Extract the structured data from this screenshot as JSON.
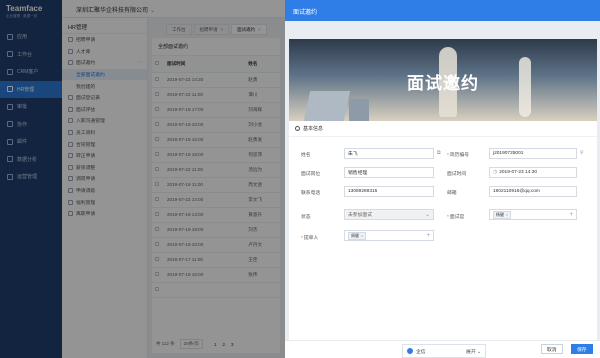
{
  "brand": {
    "name": "Teamface",
    "subtitle": "企业管理 · 数据一切"
  },
  "nav": [
    "应用",
    "工作台",
    "CRM客户",
    "HR管理",
    "审批",
    "协作",
    "邮件",
    "数据分析",
    "运营管理"
  ],
  "nav_active_index": 3,
  "topbar": {
    "company": "深圳汇聚华企科技有限公司",
    "chevron": "⌄"
  },
  "submenu": {
    "title": "HR管理",
    "items": [
      {
        "label": "招聘申请",
        "child": false
      },
      {
        "label": "人才库",
        "child": false
      },
      {
        "label": "面试邀约",
        "child": false,
        "more": "···"
      },
      {
        "label": "全部面试邀约",
        "child": true,
        "selected": true
      },
      {
        "label": "我创建的",
        "child": true
      },
      {
        "label": "面试登记表",
        "child": false
      },
      {
        "label": "面试评估",
        "child": false
      },
      {
        "label": "入职沟通管理",
        "child": false
      },
      {
        "label": "员工资料",
        "child": false
      },
      {
        "label": "合同管理",
        "child": false
      },
      {
        "label": "转正申请",
        "child": false
      },
      {
        "label": "薪资调整",
        "child": false
      },
      {
        "label": "调岗申请",
        "child": false
      },
      {
        "label": "申请调级",
        "child": false
      },
      {
        "label": "福利管理",
        "child": false
      },
      {
        "label": "离职申请",
        "child": false
      }
    ]
  },
  "tabs": [
    {
      "label": "工作台",
      "active": false
    },
    {
      "label": "招聘申请",
      "active": false,
      "close": "×"
    },
    {
      "label": "面试邀约",
      "active": true,
      "close": "×"
    }
  ],
  "table": {
    "title": "全部面试邀约",
    "headers": [
      "面试时间",
      "姓名"
    ],
    "rows": [
      [
        "2019-07-22 14:30",
        "赵勇"
      ],
      [
        "2019-07-22 11:00",
        "谭川"
      ],
      [
        "2019-07-18 17:00",
        "刘海辉"
      ],
      [
        "2019-07-19 10:00",
        "刘小龙"
      ],
      [
        "2019-07-19 16:00",
        "赵勇发"
      ],
      [
        "2019-07-19 18:00",
        "何思萍"
      ],
      [
        "2019-07-22 11:00",
        "汤远为"
      ],
      [
        "2019-07-19 11:00",
        "周文逊"
      ],
      [
        "2019-07-22 14:00",
        "李文飞"
      ],
      [
        "2019-07-19 14:00",
        "黄意升"
      ],
      [
        "2019-07-19 18:00",
        "刘杰"
      ],
      [
        "2019-07-19 10:00",
        "卢丹文"
      ],
      [
        "2019-07-17 11:00",
        "王佳"
      ],
      [
        "2019-07-19 16:00",
        "张伟"
      ],
      [
        "",
        ""
      ]
    ],
    "pager": {
      "total": "共 112 条",
      "page_size": "20条/页",
      "pages": [
        "1",
        "2",
        "3"
      ]
    }
  },
  "drawer": {
    "title": "面试邀约",
    "banner_title": "面试邀约",
    "section": "基本信息",
    "fields": {
      "name_label": "姓名",
      "name_value": "朱飞",
      "resume_label": "简历编号",
      "resume_value": "j20190725001",
      "position_label": "面试岗位",
      "position_value": "销售经理",
      "time_label": "面试时间",
      "time_value": "2019-07-23 14:30",
      "phone_label": "联系电话",
      "phone_value": "13089289315",
      "email_label": "邮箱",
      "email_value": "1902110916@qq.com",
      "status_label": "状态",
      "status_value": "未参加面试",
      "interviewer_label": "面试官",
      "interviewer_chip": "杨健",
      "submitter_label": "提单人",
      "submitter_chip": "周健"
    },
    "buttons": {
      "cancel": "取消",
      "save": "保存"
    }
  },
  "chatbar": {
    "label": "企信",
    "expand": "展开 ⌄"
  }
}
